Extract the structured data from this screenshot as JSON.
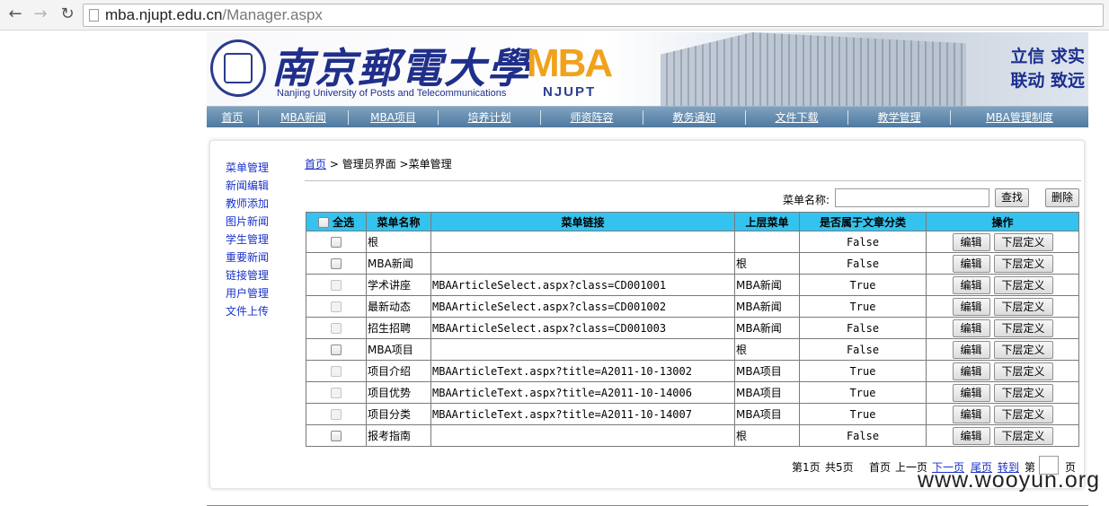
{
  "browser": {
    "url_host": "mba.njupt.edu.cn",
    "url_path": "/Manager.aspx"
  },
  "header": {
    "school_name_cn": "南京郵電大學",
    "school_name_en": "Nanjing University of Posts and Telecommunications",
    "mba_logo_mba": "MBA",
    "mba_logo_njupt": "NJUPT",
    "motto_line1": "立信 求实",
    "motto_line2": "联动 致远"
  },
  "nav": [
    {
      "label": "首页"
    },
    {
      "label": "MBA新闻"
    },
    {
      "label": "MBA项目"
    },
    {
      "label": "培养计划"
    },
    {
      "label": "师资阵容"
    },
    {
      "label": "教务通知"
    },
    {
      "label": "文件下载"
    },
    {
      "label": "教学管理"
    },
    {
      "label": "MBA管理制度"
    }
  ],
  "sidebar": [
    {
      "label": "菜单管理"
    },
    {
      "label": "新闻编辑"
    },
    {
      "label": "教师添加"
    },
    {
      "label": "图片新闻"
    },
    {
      "label": "学生管理"
    },
    {
      "label": "重要新闻"
    },
    {
      "label": "链接管理"
    },
    {
      "label": "用户管理"
    },
    {
      "label": "文件上传"
    }
  ],
  "breadcrumb": {
    "home": "首页",
    "sep": ">",
    "path": "管理员界面 >菜单管理"
  },
  "search": {
    "label": "菜单名称:",
    "value": "",
    "search_button": "查找",
    "delete_button": "删除"
  },
  "table": {
    "headers": {
      "select_all": "全选",
      "name": "菜单名称",
      "link": "菜单链接",
      "parent": "上层菜单",
      "is_category": "是否属于文章分类",
      "actions": "操作"
    },
    "edit_label": "编辑",
    "sub_label": "下层定义",
    "rows": [
      {
        "name": "根",
        "link": "",
        "parent": "",
        "is_category": "False"
      },
      {
        "name": "MBA新闻",
        "link": "",
        "parent": "根",
        "is_category": "False"
      },
      {
        "name": "学术讲座",
        "link": "MBAArticleSelect.aspx?class=CD001001",
        "parent": "MBA新闻",
        "is_category": "True"
      },
      {
        "name": "最新动态",
        "link": "MBAArticleSelect.aspx?class=CD001002",
        "parent": "MBA新闻",
        "is_category": "True"
      },
      {
        "name": "招生招聘",
        "link": "MBAArticleSelect.aspx?class=CD001003",
        "parent": "MBA新闻",
        "is_category": "False"
      },
      {
        "name": "MBA项目",
        "link": "",
        "parent": "根",
        "is_category": "False"
      },
      {
        "name": "项目介绍",
        "link": "MBAArticleText.aspx?title=A2011-10-13002",
        "parent": "MBA项目",
        "is_category": "True"
      },
      {
        "name": "项目优势",
        "link": "MBAArticleText.aspx?title=A2011-10-14006",
        "parent": "MBA项目",
        "is_category": "True"
      },
      {
        "name": "项目分类",
        "link": "MBAArticleText.aspx?title=A2011-10-14007",
        "parent": "MBA项目",
        "is_category": "True"
      },
      {
        "name": "报考指南",
        "link": "",
        "parent": "根",
        "is_category": "False"
      }
    ]
  },
  "pager": {
    "current": "第1页",
    "total": "共5页",
    "first": "首页",
    "prev": "上一页",
    "next": "下一页",
    "last": "尾页",
    "goto": "转到",
    "page_prefix": "第",
    "page_suffix": "页",
    "page_input": ""
  },
  "watermark": "www.wooyun.org"
}
